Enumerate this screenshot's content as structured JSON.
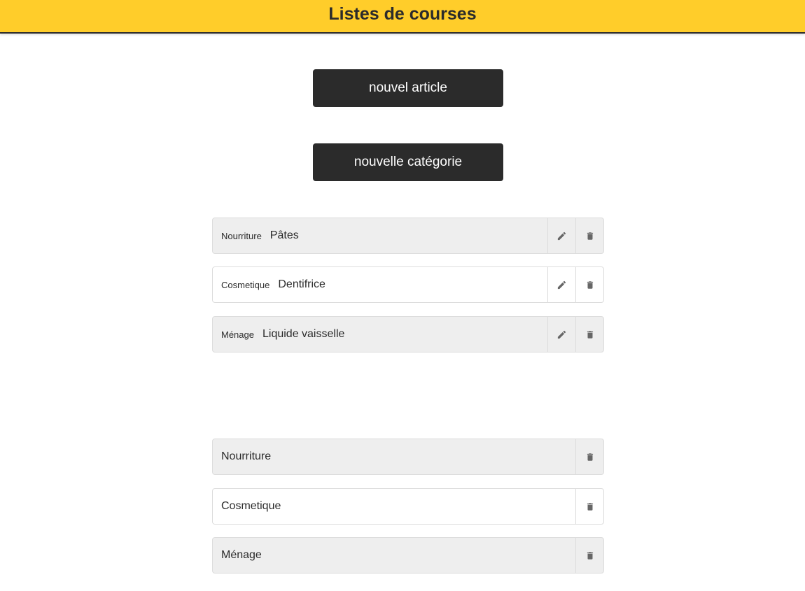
{
  "header": {
    "title": "Listes de courses"
  },
  "actions": {
    "new_article_label": "nouvel article",
    "new_category_label": "nouvelle catégorie"
  },
  "articles": [
    {
      "category": "Nourriture",
      "name": "Pâtes",
      "edit_icon": "pencil-icon",
      "delete_icon": "trash-icon"
    },
    {
      "category": "Cosmetique",
      "name": "Dentifrice",
      "edit_icon": "pencil-icon",
      "delete_icon": "trash-icon"
    },
    {
      "category": "Ménage",
      "name": "Liquide vaisselle",
      "edit_icon": "pencil-icon",
      "delete_icon": "trash-icon"
    }
  ],
  "categories": [
    {
      "name": "Nourriture",
      "delete_icon": "trash-icon"
    },
    {
      "name": "Cosmetique",
      "delete_icon": "trash-icon"
    },
    {
      "name": "Ménage",
      "delete_icon": "trash-icon"
    }
  ],
  "colors": {
    "header_bg": "#ffcd2a",
    "button_bg": "#2b2b2b",
    "row_shaded": "#eeeeee",
    "icon": "#666666"
  }
}
